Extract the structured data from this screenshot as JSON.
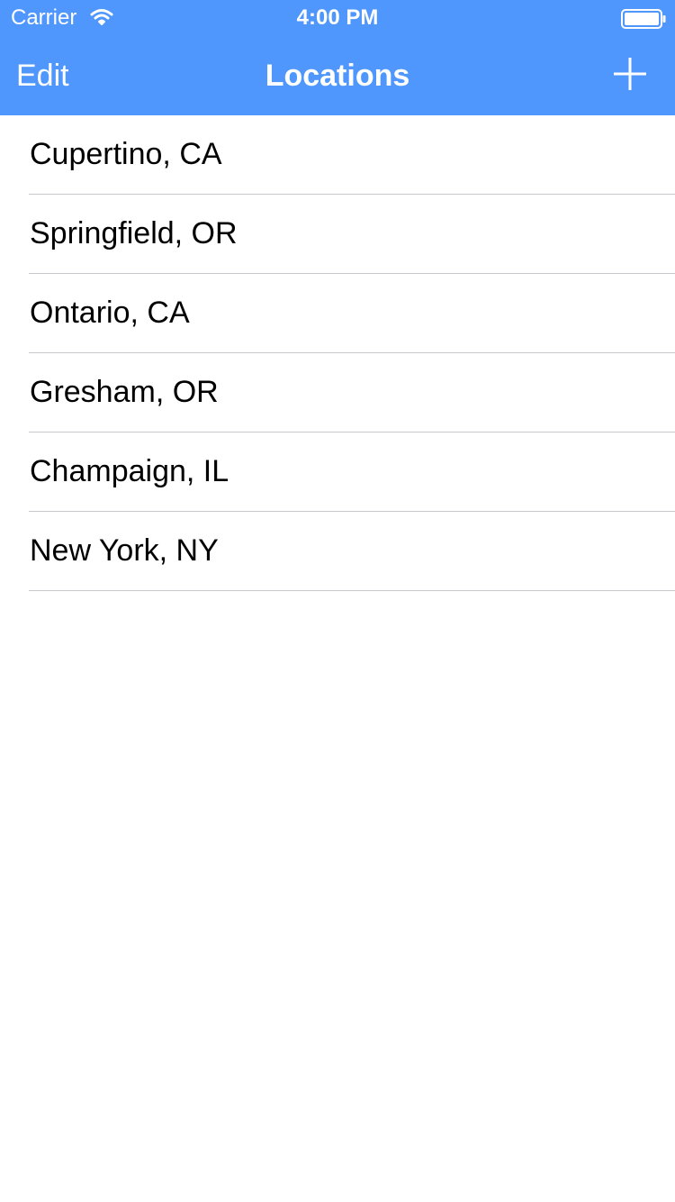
{
  "status_bar": {
    "carrier": "Carrier",
    "time": "4:00 PM",
    "wifi_icon": "wifi-icon",
    "battery_icon": "battery-icon"
  },
  "nav": {
    "edit_label": "Edit",
    "title": "Locations",
    "add_icon": "plus-icon",
    "background_color": "#4f97fd"
  },
  "locations": [
    {
      "label": "Cupertino, CA"
    },
    {
      "label": "Springfield, OR"
    },
    {
      "label": "Ontario, CA"
    },
    {
      "label": "Gresham, OR"
    },
    {
      "label": "Champaign, IL"
    },
    {
      "label": "New York, NY"
    }
  ]
}
